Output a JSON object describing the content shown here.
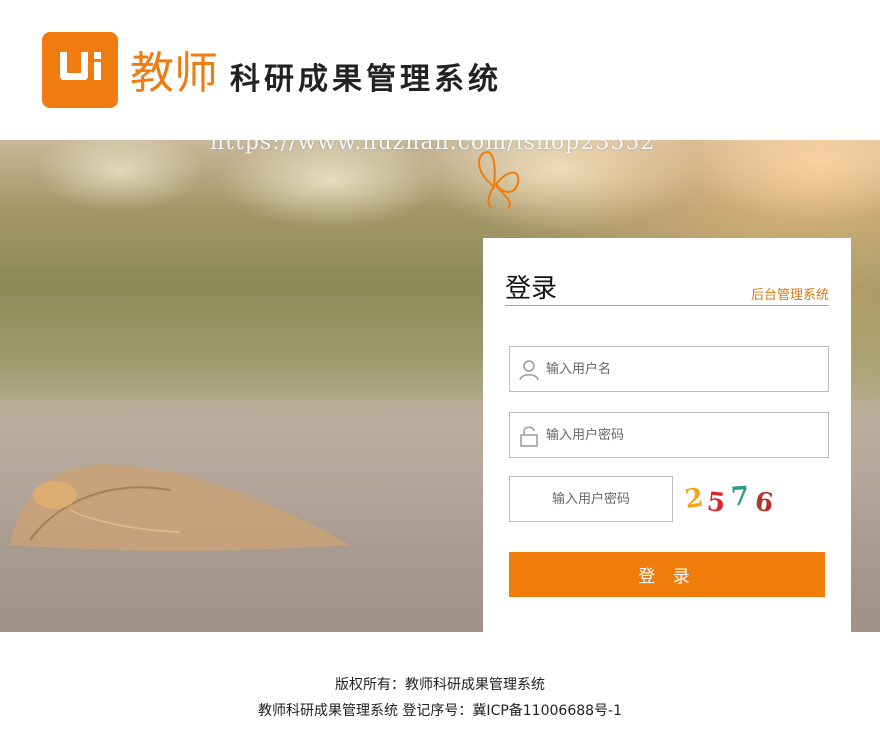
{
  "header": {
    "logo_text": "Ui",
    "title_main": "教师",
    "title_sub": "科研成果管理系统"
  },
  "hero": {
    "watermark": "https://www.huzhan.com/ishop23552"
  },
  "login": {
    "title": "登录",
    "admin_link": "后台管理系统",
    "username_placeholder": "输入用户名",
    "password_placeholder": "输入用户密码",
    "captcha_placeholder": "输入用户密码",
    "captcha_digits": [
      {
        "char": "2",
        "color": "#f3a51a"
      },
      {
        "char": "5",
        "color": "#d9262c"
      },
      {
        "char": "7",
        "color": "#2a9a8c"
      },
      {
        "char": "6",
        "color": "#b2342a"
      }
    ],
    "submit_label": "登 录"
  },
  "footer": {
    "copyright": "版权所有：教师科研成果管理系统",
    "icp": "教师科研成果管理系统 登记序号：冀ICP备11006688号-1"
  },
  "colors": {
    "accent": "#f07c10",
    "accent_dark": "#d87a14"
  }
}
